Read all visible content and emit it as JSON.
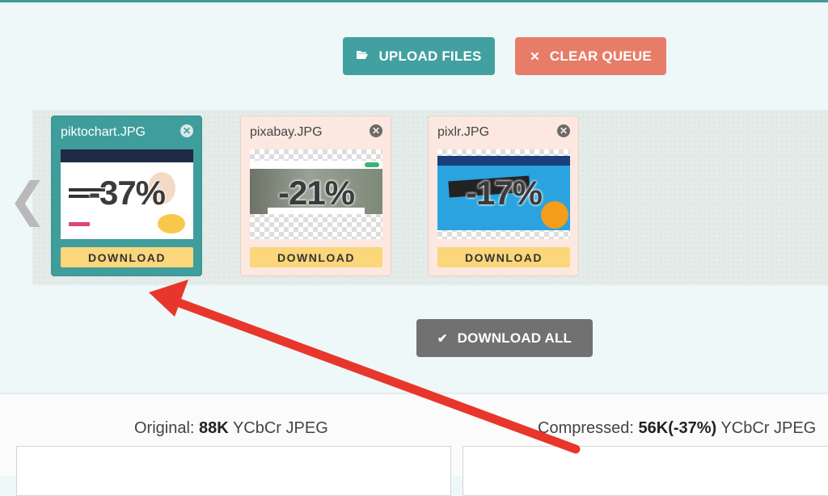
{
  "toolbar": {
    "upload_label": "UPLOAD FILES",
    "upload_icon": "folder-open-icon",
    "clear_label": "CLEAR QUEUE",
    "clear_icon": "close-icon"
  },
  "queue": {
    "files": [
      {
        "name": "piktochart.JPG",
        "percent": "-37%",
        "download_label": "DOWNLOAD",
        "selected": true
      },
      {
        "name": "pixabay.JPG",
        "percent": "-21%",
        "download_label": "DOWNLOAD",
        "selected": false
      },
      {
        "name": "pixlr.JPG",
        "percent": "-17%",
        "download_label": "DOWNLOAD",
        "selected": false
      }
    ]
  },
  "download_all": {
    "label": "DOWNLOAD ALL",
    "icon": "checkmark-icon"
  },
  "comparison": {
    "original": {
      "prefix": "Original:",
      "size": "88K",
      "format": "YCbCr JPEG"
    },
    "compressed": {
      "prefix": "Compressed:",
      "size": "56K(-37%)",
      "format": "YCbCr JPEG"
    }
  },
  "colors": {
    "accent": "#43a0a0",
    "clear": "#e77d68",
    "download": "#fbd67a",
    "download_all": "#717171",
    "annotation_arrow": "#e8362c"
  }
}
